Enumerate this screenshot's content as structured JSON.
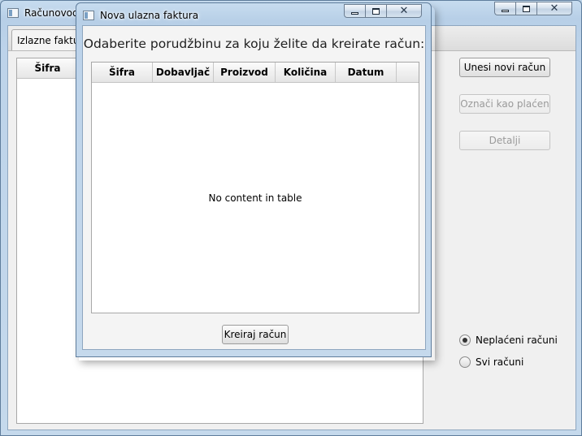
{
  "main_window": {
    "title": "Računovodstvo",
    "tab_label": "Izlazne fakture",
    "table_columns": [
      "Šifra"
    ],
    "buttons": {
      "new_invoice": "Unesi novi račun",
      "mark_paid": "Označi kao plaćen",
      "details": "Detalji"
    },
    "filter": {
      "options": [
        {
          "label": "Neplaćeni računi",
          "checked": true
        },
        {
          "label": "Svi računi",
          "checked": false
        }
      ]
    }
  },
  "dialog": {
    "title": "Nova ulazna faktura",
    "prompt": "Odaberite porudžbinu za koju želite da kreirate račun:",
    "columns": [
      "Šifra",
      "Dobavljač",
      "Proizvod",
      "Količina",
      "Datum"
    ],
    "empty_message": "No content in table",
    "create_button": "Kreiraj račun"
  },
  "icons": {
    "app": "app-window-icon",
    "minimize": "minimize-icon",
    "maximize": "maximize-icon",
    "close": "close-icon"
  }
}
